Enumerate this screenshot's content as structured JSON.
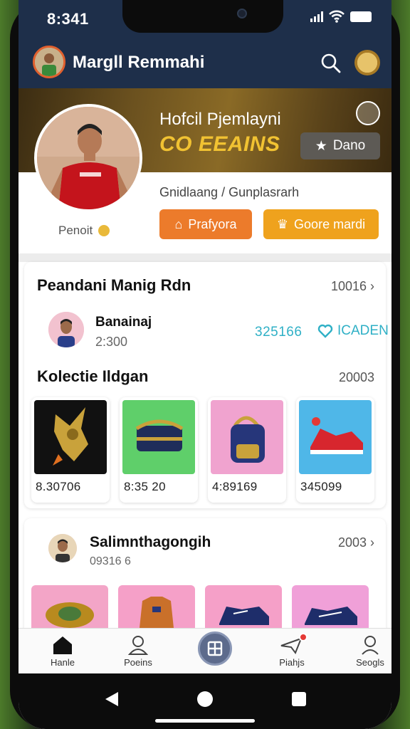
{
  "status": {
    "time": "8:341"
  },
  "header": {
    "title": "Margll Remmahi"
  },
  "hero": {
    "title": "Hofcil Pjemlayni",
    "subtitle": "EEAINS",
    "subtitle_prefix": "CO",
    "date_button": "Dano",
    "profile_label": "Penoit",
    "handle": "Gnidlaang / Gunplasrarh",
    "button_primary": "Prafyora",
    "button_secondary": "Goore mardi"
  },
  "section1": {
    "title": "Peandani Manig Rdn",
    "count": "10016",
    "row": {
      "name": "Banainaj",
      "sub": "2:300",
      "number": "325166",
      "link": "ICADEN"
    }
  },
  "collection": {
    "title": "Kolectie Ildgan",
    "count": "20003",
    "items": [
      {
        "price": "8.30706",
        "icon": "gold-trophy-icon",
        "bg": "#111111"
      },
      {
        "price": "8:35 20",
        "icon": "bag-icon",
        "bg": "#5fcf6a"
      },
      {
        "price": "4:89169",
        "icon": "backpack-icon",
        "bg": "#f0a3cf"
      },
      {
        "price": "345099",
        "icon": "sneaker-icon",
        "bg": "#4fb7e8"
      }
    ]
  },
  "section2": {
    "title": "Salimnthagongih",
    "count": "2003",
    "sub": "09316 6",
    "thumbs": [
      {
        "icon": "ring-icon",
        "bg": "#f3a5c7"
      },
      {
        "icon": "jersey-icon",
        "bg": "#f5a0c8"
      },
      {
        "icon": "boot-icon",
        "bg": "#f5a0c8"
      },
      {
        "icon": "boot-icon",
        "bg": "#f0a0d8"
      }
    ]
  },
  "nav": {
    "home": "Hanle",
    "profile": "Poeins",
    "center": "",
    "flight": "Piahjs",
    "user": "Seogls"
  }
}
